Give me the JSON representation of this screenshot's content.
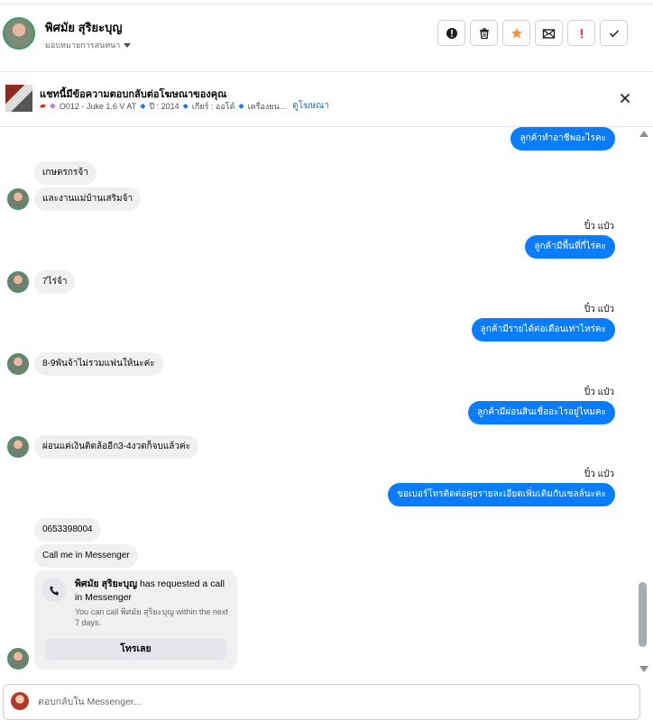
{
  "header": {
    "contact_name": "พิศมัย สุริยะบุญ",
    "assign_label": "มอบหมายการสนทนา",
    "actions": [
      {
        "name": "alert-button",
        "icon": "info-circle-icon"
      },
      {
        "name": "delete-button",
        "icon": "trash-icon"
      },
      {
        "name": "star-button",
        "icon": "star-icon"
      },
      {
        "name": "mark-unread-button",
        "icon": "envelope-icon"
      },
      {
        "name": "spam-button",
        "icon": "exclamation-icon"
      },
      {
        "name": "done-button",
        "icon": "checkmark-icon"
      }
    ],
    "colors": {
      "star": "#f7923b",
      "spam": "#e41e3f"
    }
  },
  "ad_bar": {
    "title": "แชทนี้มีข้อความตอบกลับต่อโฆษณาของคุณ",
    "meta_item_1": "O012 - Juke 1.6 V AT",
    "meta_item_2": "ปี : 2014",
    "meta_item_3": "เกียร์ : ออโต้",
    "meta_item_4": "เครื่องยน...",
    "view_ad_label": "ดูโฆษณา"
  },
  "messages": {
    "out_1": "ลูกค้าทำอาชีพอะไรคะ",
    "in_1": "เกษตรกรจ้า",
    "in_2": "และงานแม่บ้านเสริมจ้า",
    "sender_1": "ปิ๋ว แป๋ว",
    "out_2": "ลูกค้ามีพื้นที่กี่ไร่คะ",
    "in_3": "7ไร่จ้า",
    "sender_2": "ปิ๋ว แป๋ว",
    "out_3": "ลูกค้ามีรายได้ต่อเดือนเท่าไหร่คะ",
    "in_4": "8-9พันจ้าไม่รวมแฟนให้นะค่ะ",
    "sender_3": "ปิ๋ว แป๋ว",
    "out_4": "ลูกค้ามีผ่อนสินเชื่ออะไรอยู่ไหมคะ",
    "in_5": "ผ่อนแค่เงินติดล้ออีก3-4งวดก็จบแล้วค่ะ",
    "sender_4": "ปิ๋ว แป๋ว",
    "out_5": "ขอเบอร์โทรติดต่อคุยรายละเอียดเพิ่มเติมกับเซลล์นะคะ",
    "in_6": "0653398004",
    "in_7": "Call me in Messenger"
  },
  "call_request": {
    "name": "พิศมัย สุริยะบุญ",
    "title_rest": " has requested a call in Messenger",
    "subtitle": "You can call พิศมัย สุริยะบุญ within the next 7 days.",
    "button_label": "โทรเลย"
  },
  "composer": {
    "placeholder": "ตอบกลับใน Messenger..."
  },
  "accent_color": "#0a7cff"
}
